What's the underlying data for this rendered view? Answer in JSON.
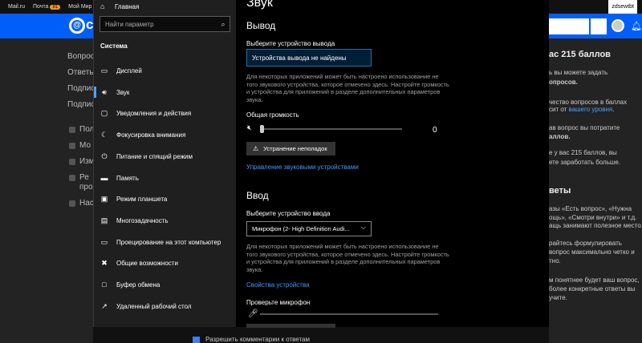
{
  "browser": {
    "top_links": [
      "Mail.ru",
      "Почта",
      "Мой Мир"
    ],
    "mail_badge": "81",
    "user": "zdsewtbt"
  },
  "bg_left": [
    "Вопрос",
    "Ответь",
    "Подпис",
    "Подпис",
    "Пол",
    "Мо",
    "Изм",
    "Ре",
    "про",
    "Нас"
  ],
  "bg_right": {
    "heading": "ас 215 баллов",
    "lines": [
      "ь вы можете задать",
      "опросов.",
      "чество вопросов в баллах",
      "сит от",
      "ав вопрос вы потратите",
      "аллов.",
      "е у вас 215 баллов, вы",
      "ете заработать больше.",
      "веты",
      "азы «Есть вопрос», «Нужна",
      "ощь», «Смотри внутри» и т.д.",
      "ащь занимают полезное место.",
      "райтесь формулировать",
      "вопрос максимально четко и",
      "тно.",
      "м понятнее будет ваш вопрос,",
      "более конкретные ответы вы",
      "учите."
    ],
    "link": "вашего уровня",
    "link_suffix": "."
  },
  "bg_bottom_label": "Разрешить комментарии к ответам",
  "settings": {
    "nav": {
      "home": "Главная",
      "search_placeholder": "Найти параметр",
      "section": "Система",
      "items": [
        {
          "label": "Дисплей",
          "icon": "display-icon"
        },
        {
          "label": "Звук",
          "icon": "speaker-icon",
          "active": true
        },
        {
          "label": "Уведомления и действия",
          "icon": "notifications-icon"
        },
        {
          "label": "Фокусировка внимания",
          "icon": "moon-icon"
        },
        {
          "label": "Питание и спящий режим",
          "icon": "power-icon"
        },
        {
          "label": "Память",
          "icon": "storage-icon"
        },
        {
          "label": "Режим планшета",
          "icon": "tablet-icon"
        },
        {
          "label": "Многозадачность",
          "icon": "multitasking-icon"
        },
        {
          "label": "Проецирование на этот компьютер",
          "icon": "projecting-icon"
        },
        {
          "label": "Общие возможности",
          "icon": "shared-experiences-icon"
        },
        {
          "label": "Буфер обмена",
          "icon": "clipboard-icon"
        },
        {
          "label": "Удаленный рабочий стол",
          "icon": "remote-desktop-icon"
        }
      ]
    },
    "page_title": "Звук",
    "output": {
      "heading": "Вывод",
      "device_label": "Выберите устройство вывода",
      "device_value": "Устройства вывода не найдены",
      "description": "Для некоторых приложений может быть настроено использование не того звукового устройства, которое отмечено здесь. Настройте громкость и устройства для приложений в разделе дополнительных параметров звука.",
      "volume_label": "Общая громкость",
      "volume_value": "0",
      "troubleshoot_label": "Устранение неполадок",
      "manage_link": "Управление звуковыми устройствами"
    },
    "input": {
      "heading": "Ввод",
      "device_label": "Выберите устройство ввода",
      "device_value": "Микрофон (2- High Definition Audi...",
      "description": "Для некоторых приложений может быть настроено использование не того звукового устройства, которое отмечено здесь. Настройте громкость и устройства для приложений в разделе дополнительных параметров звука.",
      "properties_link": "Свойства устройства",
      "test_label": "Проверьте микрофон"
    }
  }
}
